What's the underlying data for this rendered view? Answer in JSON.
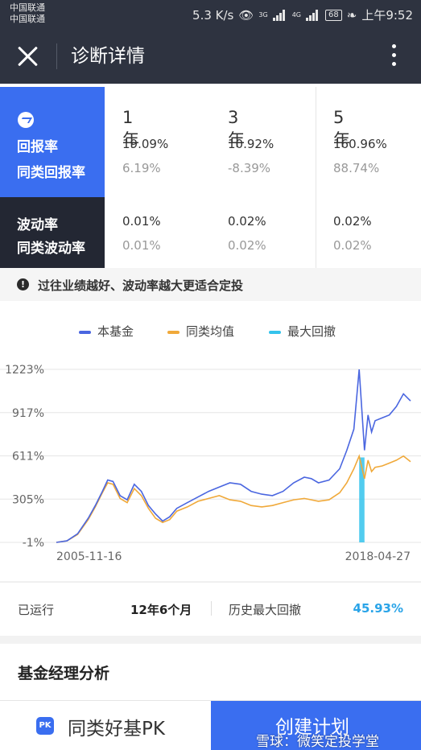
{
  "status_bar": {
    "carrier1": "中国联通",
    "carrier2": "中国联通",
    "speed": "5.3 K/s",
    "network1": "3G",
    "network2": "4G",
    "battery": "68",
    "time": "上午9:52"
  },
  "app_bar": {
    "title": "诊断详情"
  },
  "metrics": {
    "return_label": "回报率",
    "peer_return_label": "同类回报率",
    "volatility_label": "波动率",
    "peer_volatility_label": "同类波动率",
    "periods": [
      {
        "label": "1年",
        "return": "19.09%",
        "peer_return": "6.19%",
        "volatility": "0.01%",
        "peer_volatility": "0.01%"
      },
      {
        "label": "3年",
        "return": "10.92%",
        "peer_return": "-8.39%",
        "volatility": "0.02%",
        "peer_volatility": "0.02%"
      },
      {
        "label": "5年",
        "return": "160.96%",
        "peer_return": "88.74%",
        "volatility": "0.02%",
        "peer_volatility": "0.02%"
      }
    ]
  },
  "tip": {
    "text": "过往业绩越好、波动率越大更适合定投"
  },
  "chart_data": {
    "type": "line",
    "series": [
      {
        "name": "本基金",
        "color": "#4a66e0",
        "points": [
          [
            0,
            -1
          ],
          [
            0.03,
            10
          ],
          [
            0.06,
            60
          ],
          [
            0.09,
            170
          ],
          [
            0.11,
            260
          ],
          [
            0.13,
            360
          ],
          [
            0.145,
            440
          ],
          [
            0.16,
            430
          ],
          [
            0.18,
            330
          ],
          [
            0.2,
            300
          ],
          [
            0.22,
            410
          ],
          [
            0.24,
            360
          ],
          [
            0.26,
            260
          ],
          [
            0.28,
            200
          ],
          [
            0.3,
            150
          ],
          [
            0.32,
            180
          ],
          [
            0.34,
            240
          ],
          [
            0.37,
            280
          ],
          [
            0.4,
            320
          ],
          [
            0.43,
            360
          ],
          [
            0.46,
            390
          ],
          [
            0.49,
            420
          ],
          [
            0.52,
            410
          ],
          [
            0.55,
            360
          ],
          [
            0.58,
            340
          ],
          [
            0.61,
            330
          ],
          [
            0.64,
            360
          ],
          [
            0.67,
            420
          ],
          [
            0.7,
            460
          ],
          [
            0.72,
            450
          ],
          [
            0.74,
            420
          ],
          [
            0.77,
            440
          ],
          [
            0.8,
            520
          ],
          [
            0.82,
            650
          ],
          [
            0.84,
            800
          ],
          [
            0.855,
            1223
          ],
          [
            0.87,
            650
          ],
          [
            0.88,
            900
          ],
          [
            0.89,
            780
          ],
          [
            0.9,
            860
          ],
          [
            0.92,
            880
          ],
          [
            0.94,
            900
          ],
          [
            0.96,
            960
          ],
          [
            0.98,
            1050
          ],
          [
            1,
            1000
          ]
        ]
      },
      {
        "name": "同类均值",
        "color": "#f0a93a",
        "points": [
          [
            0,
            -1
          ],
          [
            0.03,
            10
          ],
          [
            0.06,
            55
          ],
          [
            0.09,
            160
          ],
          [
            0.11,
            250
          ],
          [
            0.13,
            350
          ],
          [
            0.145,
            420
          ],
          [
            0.16,
            410
          ],
          [
            0.18,
            310
          ],
          [
            0.2,
            280
          ],
          [
            0.22,
            380
          ],
          [
            0.24,
            330
          ],
          [
            0.26,
            240
          ],
          [
            0.28,
            170
          ],
          [
            0.3,
            140
          ],
          [
            0.32,
            160
          ],
          [
            0.34,
            220
          ],
          [
            0.37,
            250
          ],
          [
            0.4,
            290
          ],
          [
            0.43,
            310
          ],
          [
            0.46,
            330
          ],
          [
            0.49,
            300
          ],
          [
            0.52,
            290
          ],
          [
            0.55,
            260
          ],
          [
            0.58,
            250
          ],
          [
            0.61,
            260
          ],
          [
            0.64,
            280
          ],
          [
            0.67,
            300
          ],
          [
            0.7,
            310
          ],
          [
            0.72,
            300
          ],
          [
            0.74,
            290
          ],
          [
            0.77,
            300
          ],
          [
            0.8,
            350
          ],
          [
            0.82,
            420
          ],
          [
            0.84,
            520
          ],
          [
            0.855,
            610
          ],
          [
            0.87,
            450
          ],
          [
            0.88,
            580
          ],
          [
            0.89,
            500
          ],
          [
            0.9,
            530
          ],
          [
            0.92,
            540
          ],
          [
            0.94,
            560
          ],
          [
            0.96,
            580
          ],
          [
            0.98,
            610
          ],
          [
            1,
            570
          ]
        ]
      }
    ],
    "legend": [
      "本基金",
      "同类均值",
      "最大回撤"
    ],
    "legend_colors": [
      "#4a66e0",
      "#f0a93a",
      "#34c3ec"
    ],
    "y_ticks": [
      "1223%",
      "917%",
      "611%",
      "305%",
      "-1%"
    ],
    "y_range": [
      -1,
      1223
    ],
    "x_labels": [
      "2005-11-16",
      "2018-04-27"
    ],
    "drawdown_range": [
      0.855,
      0.87
    ]
  },
  "stats": {
    "running_label": "已运行",
    "running_value": "12年6个月",
    "max_drawdown_label": "历史最大回撤",
    "max_drawdown_value": "45.93%"
  },
  "manager": {
    "title": "基金经理分析"
  },
  "bottom_bar": {
    "pk_icon_text": "PK",
    "pk_label": "同类好基PK",
    "create_label": "创建计划"
  },
  "watermark": "雪球：微笑定投学堂"
}
